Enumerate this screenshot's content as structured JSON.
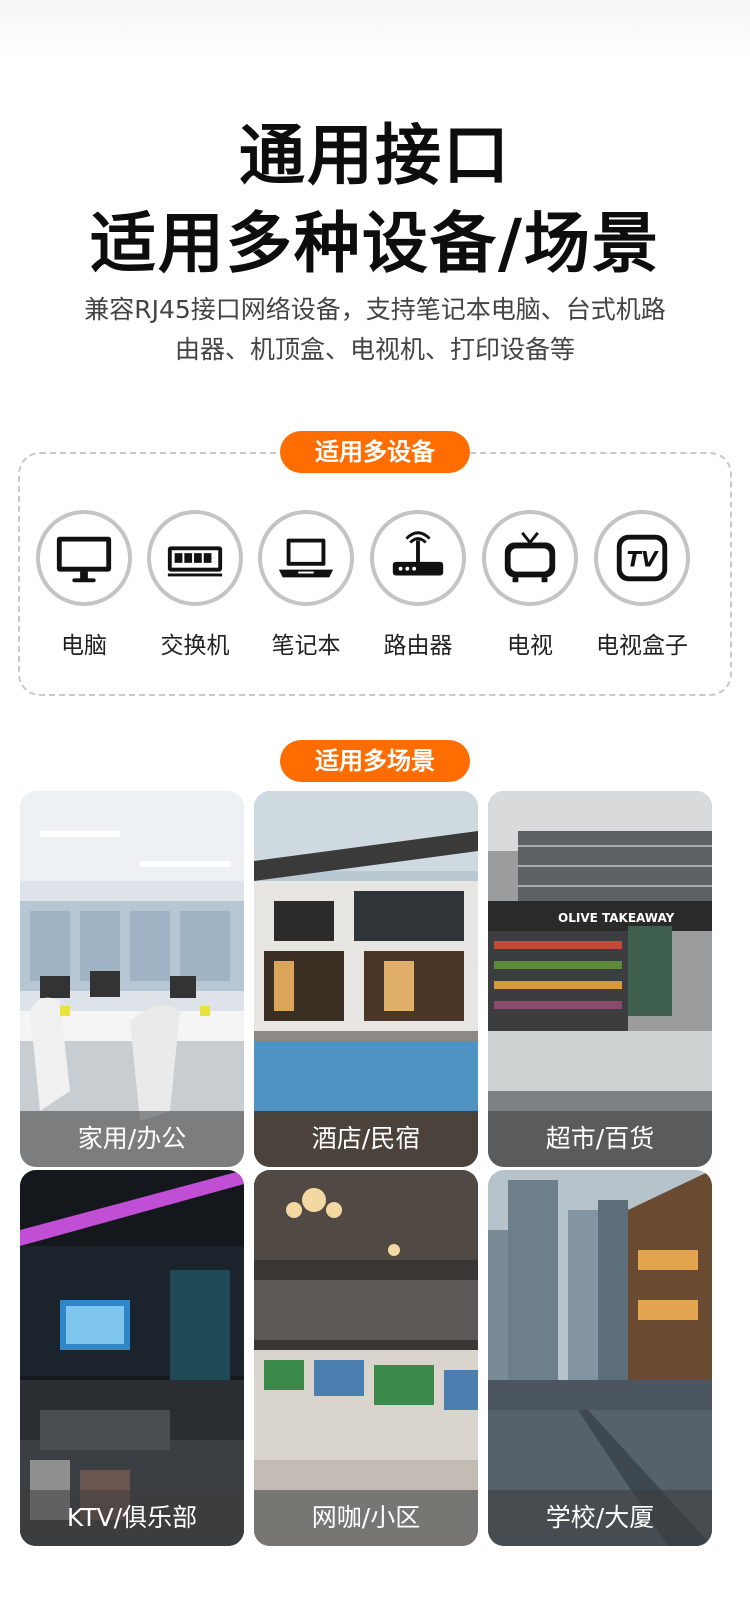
{
  "headline": {
    "line1": "通用接口",
    "line2": "适用多种设备/场景"
  },
  "description": {
    "line1": "兼容RJ45接口网络设备，支持笔记本电脑、台式机路",
    "line2": "由器、机顶盒、电视机、打印设备等"
  },
  "devices_section": {
    "badge": "适用多设备",
    "items": [
      {
        "label": "电脑",
        "icon": "monitor-icon"
      },
      {
        "label": "交换机",
        "icon": "switch-icon"
      },
      {
        "label": "笔记本",
        "icon": "laptop-icon"
      },
      {
        "label": "路由器",
        "icon": "router-icon"
      },
      {
        "label": "电视",
        "icon": "tv-icon"
      },
      {
        "label": "电视盒子",
        "icon": "tv-box-icon"
      }
    ]
  },
  "scenes_section": {
    "badge": "适用多场景",
    "items": [
      {
        "label": "家用/办公"
      },
      {
        "label": "酒店/民宿"
      },
      {
        "label": "超市/百货"
      },
      {
        "label": "KTV/俱乐部"
      },
      {
        "label": "网咖/小区"
      },
      {
        "label": "学校/大厦"
      }
    ]
  },
  "colors": {
    "accent": "#ff6d00",
    "icon_ring": "#c4c4c4",
    "title": "#0d0d0d"
  }
}
